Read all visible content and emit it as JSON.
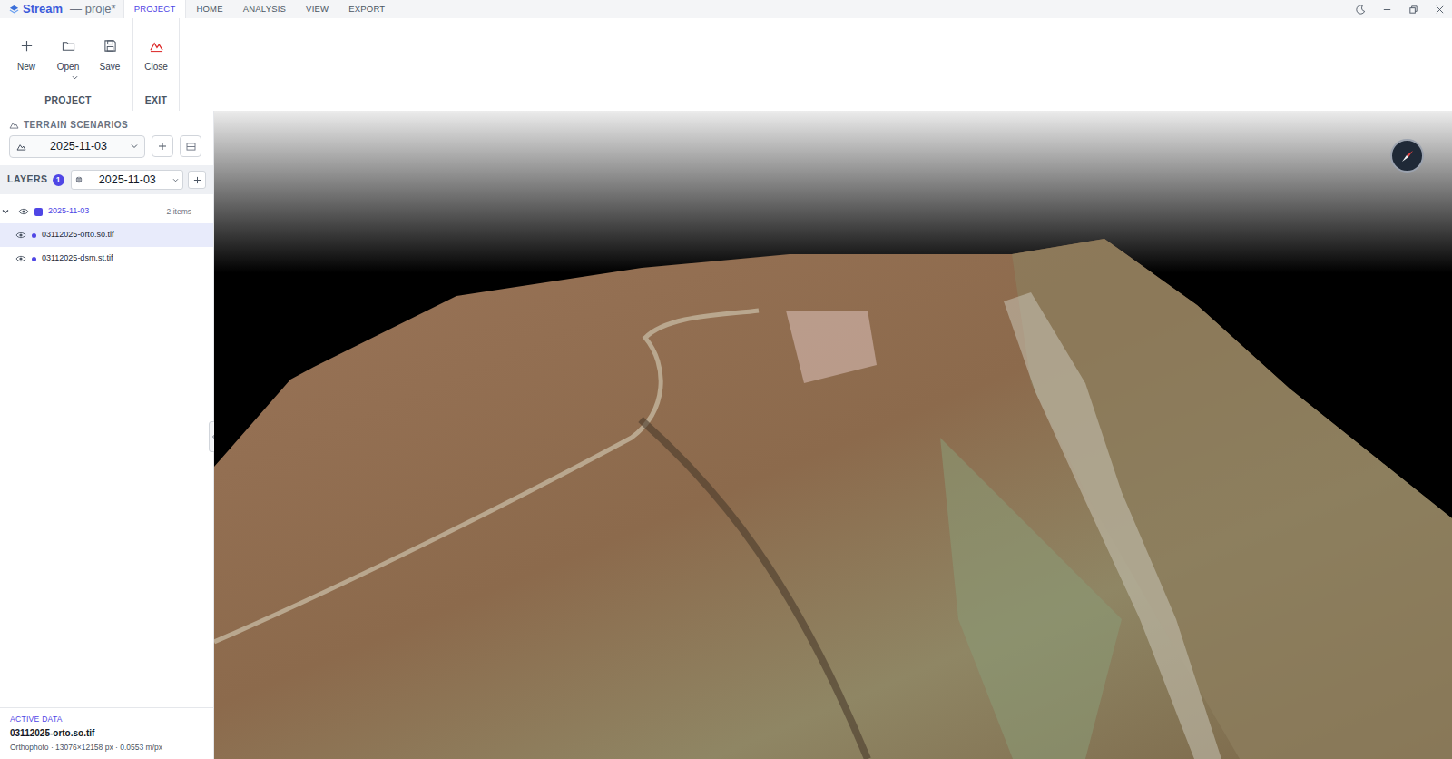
{
  "window": {
    "app": "Stream",
    "title": "— proje*"
  },
  "tabs": [
    {
      "label": "PROJECT",
      "selected": true
    },
    {
      "label": "HOME",
      "selected": false
    },
    {
      "label": "ANALYSIS",
      "selected": false
    },
    {
      "label": "VIEW",
      "selected": false
    },
    {
      "label": "EXPORT",
      "selected": false
    }
  ],
  "ribbon": {
    "groups": [
      {
        "label": "PROJECT",
        "buttons": [
          {
            "label": "New",
            "kind": "new",
            "dropdown": false
          },
          {
            "label": "Open",
            "kind": "open",
            "dropdown": true
          },
          {
            "label": "Save",
            "kind": "save",
            "dropdown": false
          }
        ]
      },
      {
        "label": "EXIT",
        "buttons": [
          {
            "label": "Close",
            "kind": "close",
            "dropdown": false
          }
        ]
      }
    ]
  },
  "terrain_scenarios": {
    "title": "TERRAIN SCENARIOS",
    "selected": "2025-11-03"
  },
  "layers": {
    "title": "LAYERS",
    "count": "1",
    "selected": "2025-11-03"
  },
  "tree": [
    {
      "label": "2025-11-03",
      "count": "2 items",
      "expanded": true,
      "visible": true,
      "children": [
        {
          "label": "03112025-orto.so.tif",
          "selected": true,
          "visible": true
        },
        {
          "label": "03112025-dsm.st.tif",
          "selected": false,
          "visible": true
        }
      ]
    }
  ],
  "active_data": {
    "title": "ACTIVE DATA",
    "name": "03112025-orto.so.tif",
    "details": "Orthophoto · 13076×12158 px · 0.0553 m/px"
  }
}
